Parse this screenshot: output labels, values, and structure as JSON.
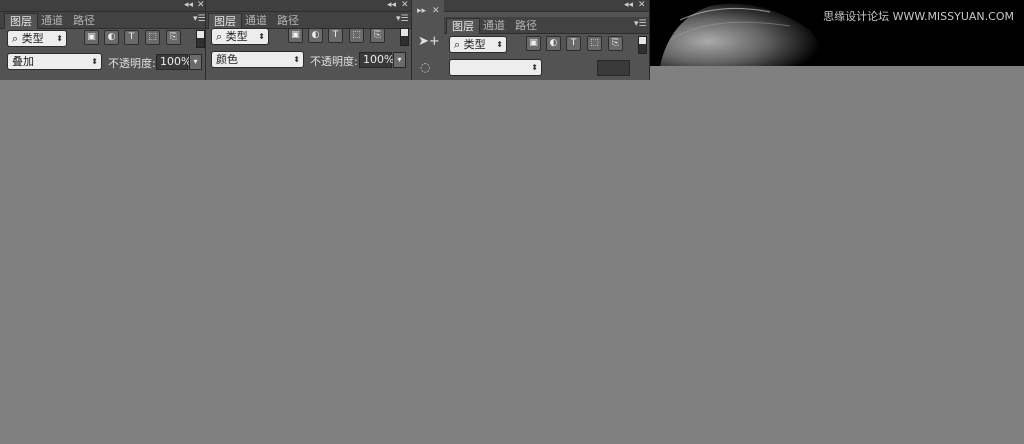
{
  "panels": [
    {
      "tabs": [
        "图层",
        "通道",
        "路径"
      ],
      "filter_label": "类型",
      "blend_mode": "叠加",
      "opacity_label": "不透明度:",
      "opacity_value": "100%"
    },
    {
      "tabs": [
        "图层",
        "通道",
        "路径"
      ],
      "filter_label": "类型",
      "blend_mode": "颜色",
      "opacity_label": "不透明度:",
      "opacity_value": "100%"
    },
    {
      "tabs": [
        "图层",
        "通道",
        "路径"
      ],
      "filter_label": "类型",
      "blend_mode": "",
      "opacity_label": "",
      "opacity_value": ""
    }
  ],
  "watermark": "思缘设计论坛 WWW.MISSYUAN.COM",
  "icons": {
    "search": "search-icon",
    "image": "image-filter-icon",
    "adjustment": "adjustment-filter-icon",
    "type": "type-filter-icon",
    "shape": "shape-filter-icon",
    "smart": "smart-object-filter-icon",
    "move": "move-tool-icon",
    "collapse": "collapse-icon",
    "close": "close-icon",
    "menu": "panel-menu-icon"
  },
  "colors": {
    "panel_bg": "#535353",
    "canvas_bg": "#808080",
    "photo_bg": "#000000"
  }
}
